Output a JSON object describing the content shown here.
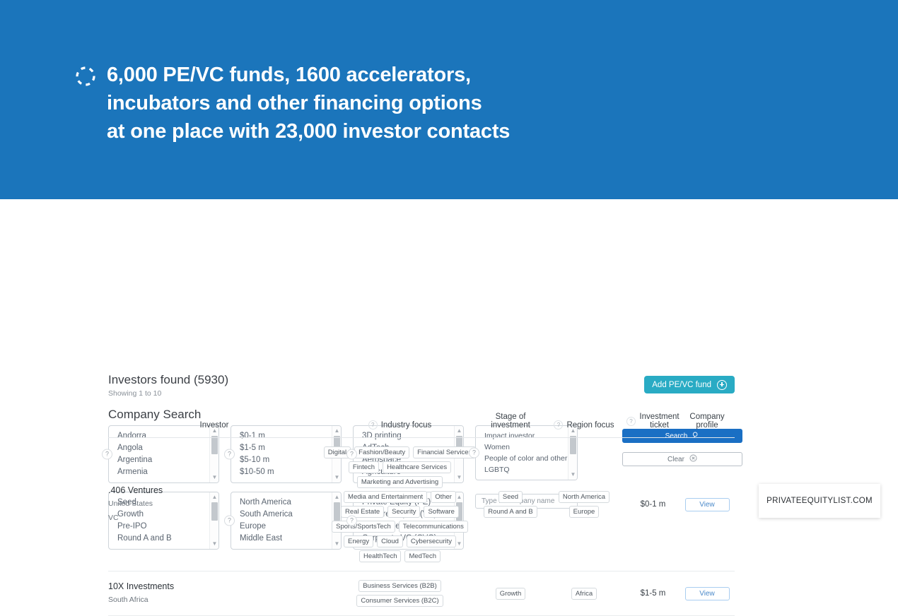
{
  "hero": {
    "icon": "dotted-circle-icon",
    "title": "6,000 PE/VC funds, 1600 accelerators,\nincubators and other financing options\nat one place with 23,000 investor contacts",
    "bg_color": "#1b75bb"
  },
  "search": {
    "panel_title": "Company Search",
    "help_marker": "?",
    "filters": [
      {
        "name": "country",
        "options": [
          "Andorra",
          "Angola",
          "Argentina",
          "Armenia"
        ]
      },
      {
        "name": "investment-ticket",
        "options": [
          "$0-1 m",
          "$1-5 m",
          "$5-10 m",
          "$10-50 m"
        ]
      },
      {
        "name": "industry-focus",
        "options": [
          "3D printing",
          "AdTech",
          "Aerospace",
          "Agriculture"
        ]
      },
      {
        "name": "stage-of-investment",
        "options": [
          "Seed",
          "Growth",
          "Pre-IPO",
          "Round A and B"
        ]
      },
      {
        "name": "region-focus",
        "options": [
          "North America",
          "South America",
          "Europe",
          "Middle East"
        ]
      },
      {
        "name": "investor-type",
        "options": [
          "Private Equity (PE)",
          "Venture Capital (VC)",
          "Angel investor",
          "Corporate VC (CVC)"
        ]
      }
    ],
    "impact_filter": {
      "name": "impact-focus",
      "options": [
        "Impact investor",
        "Women",
        "People of color and other mi",
        "LGBTQ"
      ]
    },
    "company_name_placeholder": "Type in company name",
    "company_name_value": "",
    "search_label": "Search",
    "search_icon": "magnifier-icon",
    "clear_label": "Clear",
    "clear_icon": "circle-x-icon",
    "search_button_color": "#1a6fc4"
  },
  "results": {
    "title": "Investors found (5930)",
    "showing": "Showing 1 to 10",
    "add_label": "Add PE/VC fund",
    "add_icon": "plus-circle-icon",
    "add_button_color": "#29abc4",
    "columns": [
      {
        "key": "investor",
        "label": "Investor",
        "help": false
      },
      {
        "key": "industry",
        "label": "Industry focus",
        "help": true
      },
      {
        "key": "stage",
        "label": "Stage of investment",
        "help": false
      },
      {
        "key": "region",
        "label": "Region focus",
        "help": true
      },
      {
        "key": "ticket",
        "label": "Investment ticket",
        "help": true
      },
      {
        "key": "profile",
        "label": "Company profile",
        "help": false
      }
    ],
    "view_label": "View",
    "rows": [
      {
        "name": ".406 Ventures",
        "country": "United States",
        "type": "VC",
        "industry": [
          "Digital",
          "Fashion/Beauty",
          "Financial Services",
          "Fintech",
          "Healthcare Services",
          "Marketing and Advertising",
          "Media and Entertainment",
          "Other",
          "Real Estate",
          "Security",
          "Software",
          "Sports/SportsTech",
          "Telecommunications",
          "Energy",
          "Cloud",
          "Cybersecurity",
          "HealthTech",
          "MedTech"
        ],
        "stage": [
          "Seed",
          "Round A and B"
        ],
        "region": [
          "North America",
          "Europe"
        ],
        "ticket": "$0-1 m"
      },
      {
        "name": "10X Investments",
        "country": "South Africa",
        "type": "",
        "industry": [
          "Business Services (B2B)",
          "Consumer Services (B2C)"
        ],
        "stage": [
          "Growth"
        ],
        "region": [
          "Africa"
        ],
        "ticket": "$1-5 m"
      }
    ]
  },
  "watermark": {
    "text": "PRIVATEEQUITYLIST.COM"
  }
}
